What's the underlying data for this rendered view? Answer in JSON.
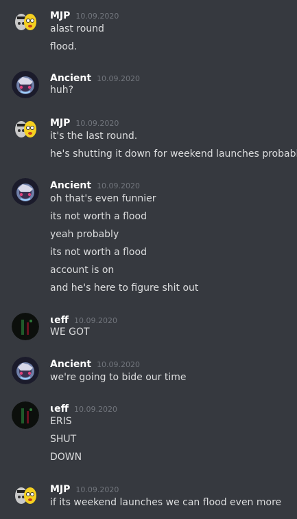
{
  "messages": [
    {
      "author": "MJP",
      "time": "10.09.2020",
      "avatar": "mjp-avatar",
      "lines": [
        "alast round",
        "flood."
      ]
    },
    {
      "author": "Ancient",
      "time": "10.09.2020",
      "avatar": "ancient-avatar",
      "lines": [
        "huh?"
      ]
    },
    {
      "author": "MJP",
      "time": "10.09.2020",
      "avatar": "mjp-avatar",
      "lines": [
        "it's the last round.",
        "he's shutting it down for weekend launches probably"
      ]
    },
    {
      "author": "Ancient",
      "time": "10.09.2020",
      "avatar": "ancient-avatar",
      "lines": [
        "oh that's even funnier",
        "its not worth a flood",
        "yeah probably",
        "its not worth a flood",
        "account is on",
        "and he's here to figure shit out"
      ]
    },
    {
      "author": "ɩeff",
      "time": "10.09.2020",
      "avatar": "jeff-avatar",
      "lines": [
        "WE GOT"
      ]
    },
    {
      "author": "Ancient",
      "time": "10.09.2020",
      "avatar": "ancient-avatar",
      "lines": [
        "we're going to bide our time"
      ]
    },
    {
      "author": "ɩeff",
      "time": "10.09.2020",
      "avatar": "jeff-avatar",
      "lines": [
        "ERIS",
        "SHUT",
        "DOWN"
      ]
    },
    {
      "author": "MJP",
      "time": "10.09.2020",
      "avatar": "mjp-avatar",
      "lines": [
        "if its weekend launches we can flood even more"
      ]
    }
  ],
  "colors": {
    "background": "#36393f",
    "username": "#ffffff",
    "text": "#dcddde",
    "timestamp": "#72767d"
  }
}
